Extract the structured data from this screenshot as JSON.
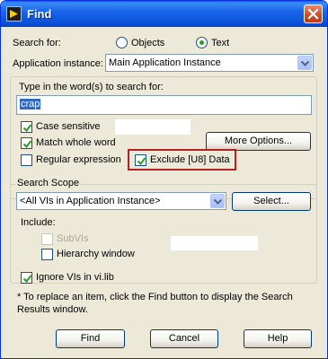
{
  "window": {
    "title": "Find",
    "icon": "labview-app-icon",
    "close_icon": "close-icon"
  },
  "search_for": {
    "label": "Search for:",
    "options": [
      {
        "label": "Objects",
        "selected": false
      },
      {
        "label": "Text",
        "selected": true
      }
    ]
  },
  "application_instance": {
    "label": "Application instance:",
    "value": "Main Application Instance"
  },
  "search_words": {
    "label": "Type in the word(s) to search for:",
    "value": "crap"
  },
  "options": {
    "case_sensitive": {
      "label": "Case sensitive",
      "checked": true
    },
    "match_whole_word": {
      "label": "Match whole word",
      "checked": true
    },
    "regular_expression": {
      "label": "Regular expression",
      "checked": false
    },
    "exclude_u8": {
      "label": "Exclude [U8] Data",
      "checked": true
    },
    "more_options_label": "More Options..."
  },
  "search_scope": {
    "title": "Search Scope",
    "value": "<All VIs in Application Instance>",
    "select_label": "Select...",
    "include_label": "Include:",
    "subvis": {
      "label": "SubVIs",
      "checked": false,
      "disabled": true
    },
    "hierarchy": {
      "label": "Hierarchy window",
      "checked": false
    },
    "ignore_vilib": {
      "label": "Ignore VIs in vi.lib",
      "checked": true
    }
  },
  "note": "* To replace an item, click the Find button to display the Search Results window.",
  "buttons": {
    "find": "Find",
    "cancel": "Cancel",
    "help": "Help"
  },
  "colors": {
    "titlebar": "#0a4fd6",
    "dialog_bg": "#ece9d8",
    "highlight_box": "#b52020",
    "selection": "#316ac5"
  }
}
